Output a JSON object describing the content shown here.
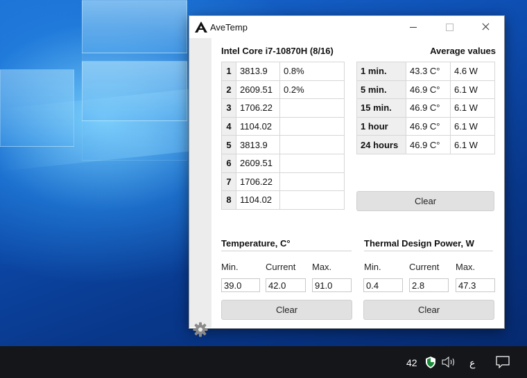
{
  "window": {
    "title": "AveTemp",
    "cpu_name": "Intel Core i7-10870H (8/16)",
    "average_title": "Average values"
  },
  "cores": [
    {
      "num": "1",
      "freq": "3813.9",
      "load": "0.8%"
    },
    {
      "num": "2",
      "freq": "2609.51",
      "load": "0.2%"
    },
    {
      "num": "3",
      "freq": "1706.22",
      "load": ""
    },
    {
      "num": "4",
      "freq": "1104.02",
      "load": ""
    },
    {
      "num": "5",
      "freq": "3813.9",
      "load": ""
    },
    {
      "num": "6",
      "freq": "2609.51",
      "load": ""
    },
    {
      "num": "7",
      "freq": "1706.22",
      "load": ""
    },
    {
      "num": "8",
      "freq": "1104.02",
      "load": ""
    }
  ],
  "averages": [
    {
      "period": "1 min.",
      "temp": "43.3 C°",
      "power": "4.6 W"
    },
    {
      "period": "5 min.",
      "temp": "46.9 C°",
      "power": "6.1 W"
    },
    {
      "period": "15 min.",
      "temp": "46.9 C°",
      "power": "6.1 W"
    },
    {
      "period": "1 hour",
      "temp": "46.9 C°",
      "power": "6.1 W"
    },
    {
      "period": "24 hours",
      "temp": "46.9 C°",
      "power": "6.1 W"
    }
  ],
  "clear_label": "Clear",
  "temperature": {
    "title": "Temperature, C°",
    "min_label": "Min.",
    "current_label": "Current",
    "max_label": "Max.",
    "min": "39.0",
    "current": "42.0",
    "max": "91.0"
  },
  "tdp": {
    "title": "Thermal Design Power, W",
    "min_label": "Min.",
    "current_label": "Current",
    "max_label": "Max.",
    "min": "0.4",
    "current": "2.8",
    "max": "47.3"
  },
  "taskbar": {
    "tray_temp": "42",
    "ime_indicator": "ع"
  },
  "icons": [
    "avetemp-logo-icon",
    "minimize-icon",
    "maximize-icon",
    "close-icon",
    "gear-icon",
    "shield-icon",
    "speaker-icon",
    "notification-icon"
  ]
}
